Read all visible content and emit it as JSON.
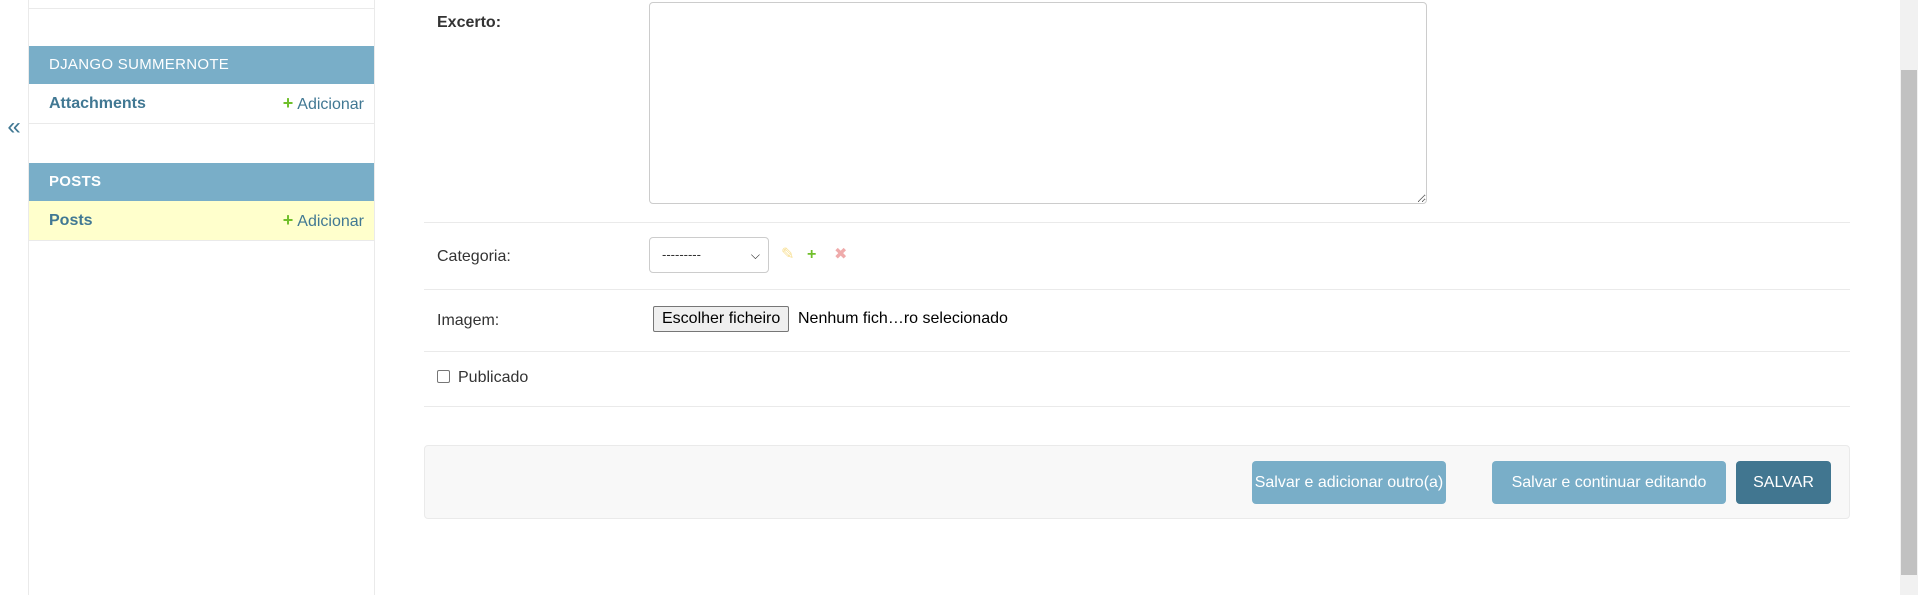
{
  "nav_toggle": {
    "glyph": "«"
  },
  "sidebar": {
    "modules": [
      {
        "caption": "DJANGO SUMMERNOTE",
        "rows": [
          {
            "label": "Attachments",
            "add_label": "Adicionar"
          }
        ]
      },
      {
        "caption": "POSTS",
        "rows": [
          {
            "label": "Posts",
            "add_label": "Adicionar",
            "current": true
          }
        ]
      }
    ]
  },
  "form": {
    "excerpt": {
      "label": "Excerto:",
      "value": ""
    },
    "category": {
      "label": "Categoria:",
      "selected": "---------",
      "icons": [
        "pencil-icon",
        "plus-icon",
        "x-icon"
      ]
    },
    "image": {
      "label": "Imagem:",
      "button_label": "Escolher ficheiro",
      "status": "Nenhum fich…ro selecionado"
    },
    "published": {
      "label": "Publicado",
      "checked": false
    }
  },
  "submit": {
    "save_add_another": "Salvar e adicionar outro(a)",
    "save_continue": "Salvar e continuar editando",
    "save": "SALVAR"
  },
  "colors": {
    "module_caption_bg": "#79aec8",
    "link": "#417893",
    "current_row_bg": "#ffffcc",
    "add_green": "#70bf2b",
    "primary_button": "#417690"
  }
}
